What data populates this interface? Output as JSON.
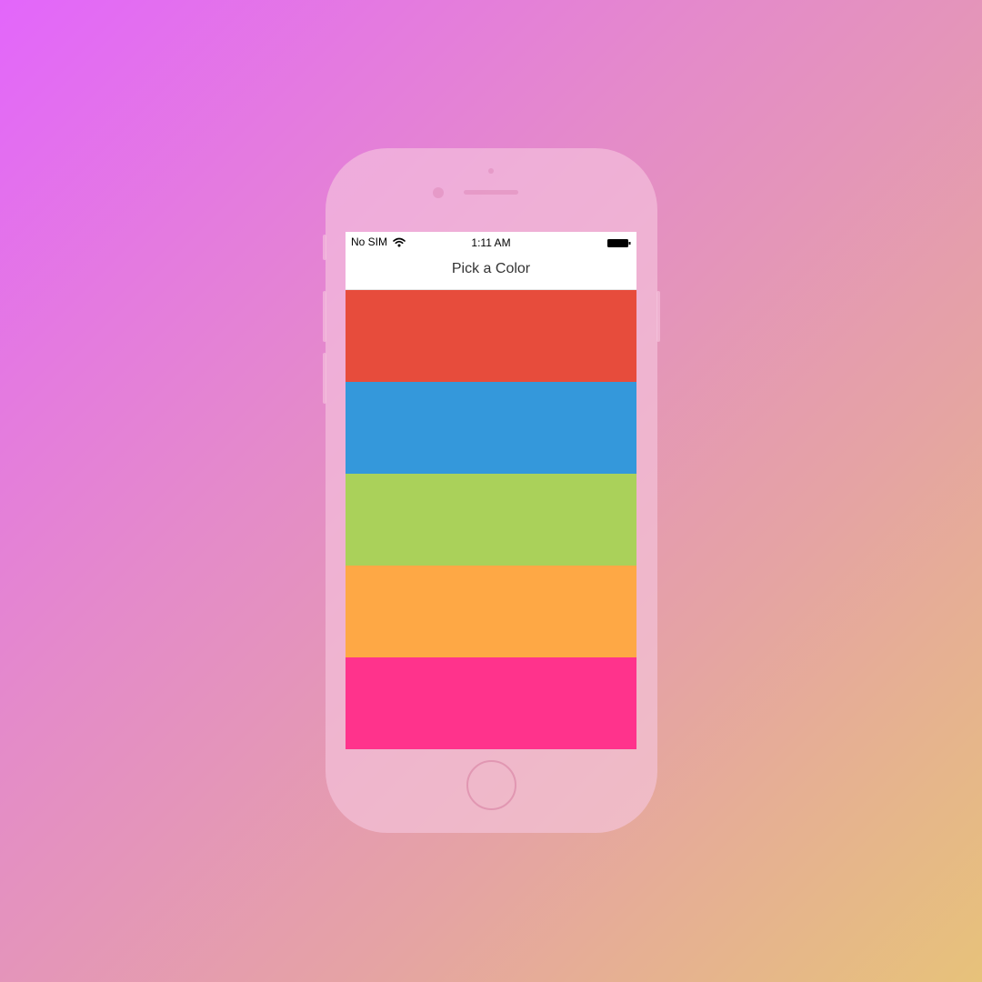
{
  "status_bar": {
    "carrier": "No SIM",
    "time": "1:11 AM",
    "icons": [
      "wifi-icon",
      "battery-icon"
    ]
  },
  "nav": {
    "title": "Pick a Color"
  },
  "colors": [
    {
      "name": "red",
      "hex": "#e74c3c"
    },
    {
      "name": "blue",
      "hex": "#3498db"
    },
    {
      "name": "green",
      "hex": "#aad15a"
    },
    {
      "name": "orange",
      "hex": "#fea845"
    },
    {
      "name": "pink",
      "hex": "#ff338c"
    }
  ],
  "device": {
    "body_color": "#f6c6de",
    "background_gradient": [
      "#e366fb",
      "#e48bc9",
      "#e5a3a4",
      "#e7c27a"
    ]
  }
}
